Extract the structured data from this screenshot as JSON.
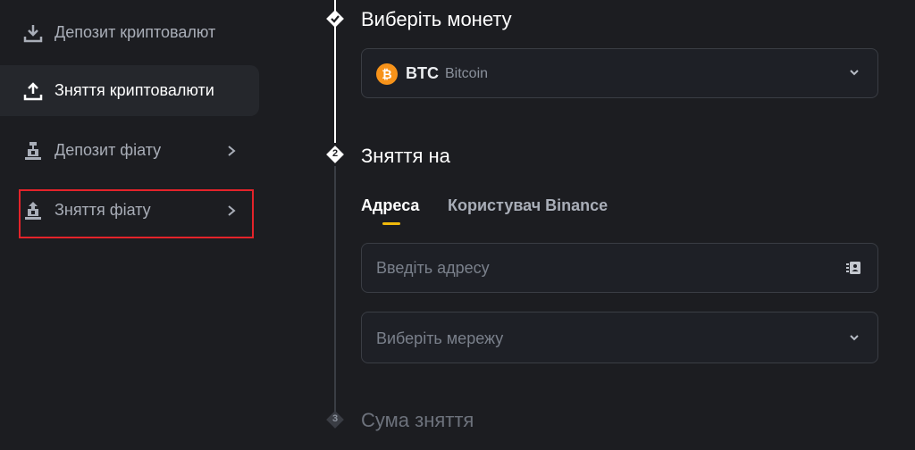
{
  "sidebar": {
    "items": [
      {
        "label": "Депозит криптовалют",
        "icon": "download-icon"
      },
      {
        "label": "Зняття криптовалюти",
        "icon": "upload-icon",
        "active": true
      },
      {
        "label": "Депозит фіату",
        "icon": "fiat-deposit-icon"
      },
      {
        "label": "Зняття фіату",
        "icon": "fiat-withdraw-icon",
        "highlighted": true
      }
    ]
  },
  "steps": {
    "step1": {
      "title": "Виберіть монету",
      "state": "done"
    },
    "step2": {
      "number": "2",
      "title": "Зняття на",
      "state": "active"
    },
    "step3": {
      "number": "3",
      "title": "Сума зняття",
      "state": "inactive"
    }
  },
  "coin_select": {
    "symbol": "BTC",
    "name": "Bitcoin",
    "icon_glyph": "₿"
  },
  "tabs": [
    {
      "label": "Адреса",
      "active": true
    },
    {
      "label": "Користувач Binance",
      "active": false
    }
  ],
  "address_input": {
    "placeholder": "Введіть адресу"
  },
  "network_select": {
    "placeholder": "Виберіть мережу"
  },
  "colors": {
    "background": "#1c1d21",
    "accent": "#f0b90b",
    "btc": "#f7931a",
    "highlight": "#e4232a"
  }
}
